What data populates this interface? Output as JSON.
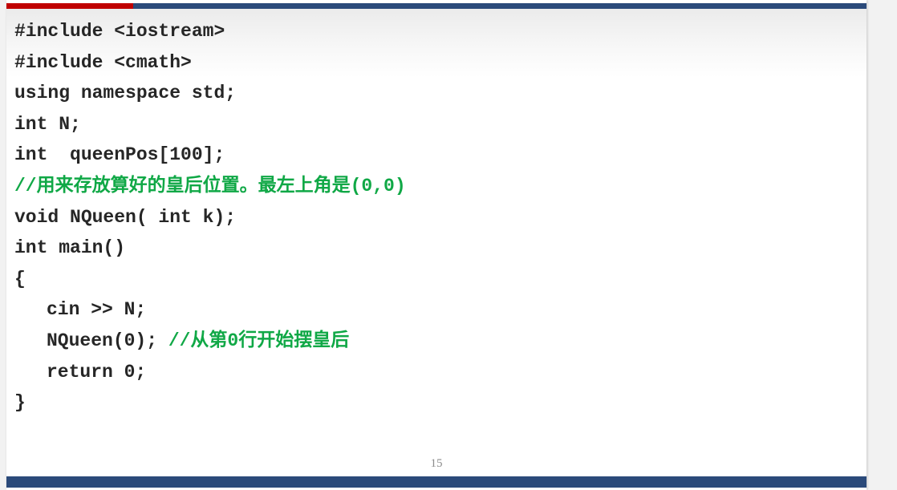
{
  "slide": {
    "colors": {
      "top_bar": "#2b4a7a",
      "top_bar_accent": "#c00000",
      "bottom_bar": "#2b4a7a",
      "code_text": "#262626",
      "comment_text": "#10a846"
    },
    "code_lines": [
      "#include <iostream>",
      "#include <cmath>",
      "using namespace std;",
      "int N;",
      "int  queenPos[100];",
      "//用来存放算好的皇后位置。最左上角是(0,0)",
      "void NQueen( int k);",
      "int main()",
      "{",
      "cin >> N;",
      "NQueen(0); ",
      "//从第0行开始摆皇后",
      "return 0;",
      "}"
    ],
    "page_number": "15"
  }
}
